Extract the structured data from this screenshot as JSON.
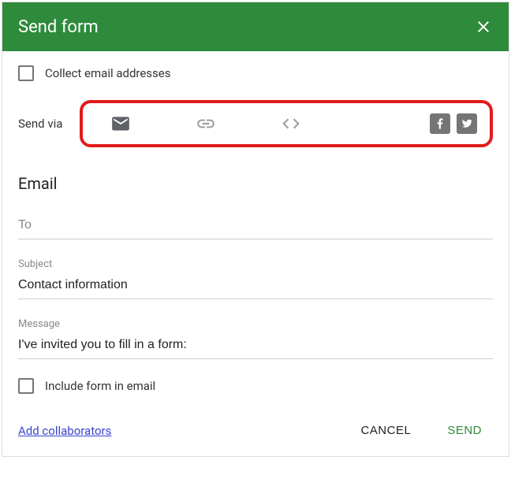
{
  "header": {
    "title": "Send form"
  },
  "collect": {
    "label": "Collect email addresses",
    "checked": false
  },
  "sendVia": {
    "label": "Send via",
    "tabs": [
      "email",
      "link",
      "embed"
    ],
    "social": [
      "facebook",
      "twitter"
    ]
  },
  "emailSection": {
    "heading": "Email",
    "to": {
      "label": "To",
      "value": ""
    },
    "subject": {
      "label": "Subject",
      "value": "Contact information"
    },
    "message": {
      "label": "Message",
      "value": "I've invited you to fill in a form:"
    },
    "includeForm": {
      "label": "Include form in email",
      "checked": false
    }
  },
  "footer": {
    "addCollaborators": "Add collaborators",
    "cancel": "CANCEL",
    "send": "SEND"
  },
  "colors": {
    "accent": "#2e8b3c",
    "highlight": "#e21b1b",
    "link": "#3b44d1"
  }
}
